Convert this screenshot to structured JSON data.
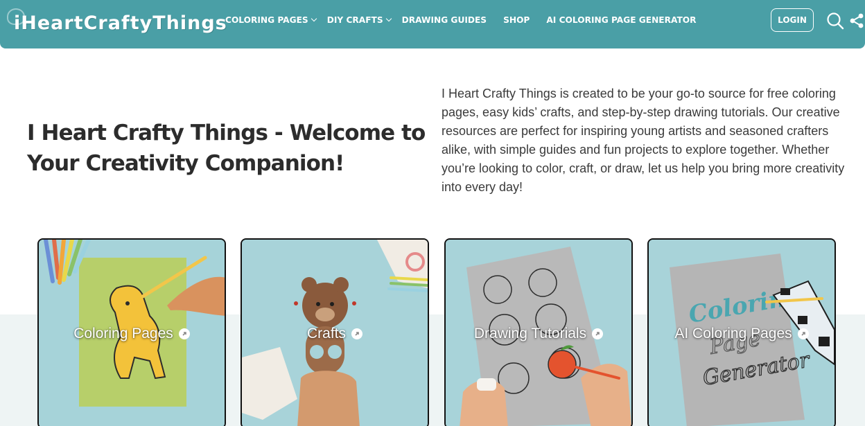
{
  "header": {
    "logo_text": "iHeartCraftyThings",
    "nav": [
      {
        "label": "COLORING PAGES",
        "dropdown": true
      },
      {
        "label": "DIY CRAFTS",
        "dropdown": true
      },
      {
        "label": "DRAWING GUIDES",
        "dropdown": false
      },
      {
        "label": "SHOP",
        "dropdown": false
      },
      {
        "label": "AI COLORING PAGE GENERATOR",
        "dropdown": false
      }
    ],
    "login_label": "LOGIN",
    "icons": [
      "search-icon",
      "share-icon"
    ],
    "bg_color": "#4a9fa6"
  },
  "hero": {
    "title": "I Heart Crafty Things - Welcome to Your Creativity Companion!",
    "description": "I Heart Crafty Things is created to be your go-to source for free coloring pages, easy kids’ crafts, and step-by-step drawing tutorials. Our creative resources are perfect for inspiring young artists and seasoned crafters alike, with simple guides and fun projects to explore together. Whether you’re looking to color, craft, or draw, let us help you bring more creativity into every day!"
  },
  "cards": [
    {
      "label": "Coloring Pages"
    },
    {
      "label": "Crafts"
    },
    {
      "label": "Drawing Tutorials"
    },
    {
      "label": "AI Coloring Pages"
    }
  ]
}
